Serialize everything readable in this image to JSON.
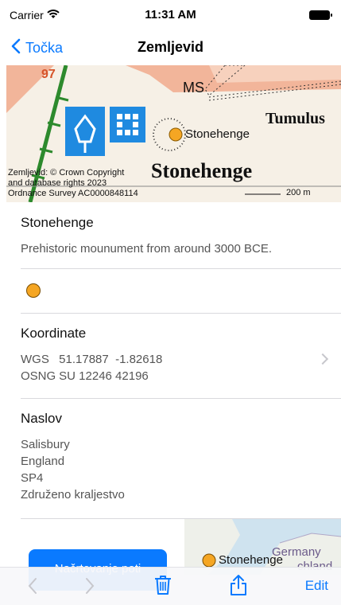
{
  "status": {
    "carrier": "Carrier",
    "time": "11:31 AM"
  },
  "nav": {
    "back_label": "Točka",
    "title": "Zemljevid"
  },
  "map": {
    "labels": [
      "97",
      "MS",
      "Tumulus",
      "Stonehenge",
      "Stonehenge"
    ],
    "copyright": [
      "Zemljevid: © Crown Copyright",
      "and database rights 2023",
      "Ordnance Survey AC0000848114"
    ],
    "scale_label": "200 m"
  },
  "place": {
    "name": "Stonehenge",
    "description": "Prehistoric mounument from around 3000 BCE."
  },
  "marker": {
    "color": "#f5a623"
  },
  "coordinates": {
    "title": "Koordinate",
    "rows": [
      {
        "label": "WGS",
        "value": "51.17887  -1.82618"
      },
      {
        "label": "OSNG",
        "value": "SU 12246 42196"
      }
    ]
  },
  "address": {
    "title": "Naslov",
    "lines": [
      "Salisbury",
      "England",
      "SP4",
      "Združeno kraljestvo"
    ]
  },
  "route_button": {
    "label": "Načrtovanje poti"
  },
  "mini_map": {
    "place_label": "Stonehenge",
    "country_label": "Germany",
    "country_label_2": "chland"
  },
  "toolbar": {
    "edit_label": "Edit"
  },
  "colors": {
    "accent": "#0a7aff",
    "marker": "#f5a623"
  }
}
